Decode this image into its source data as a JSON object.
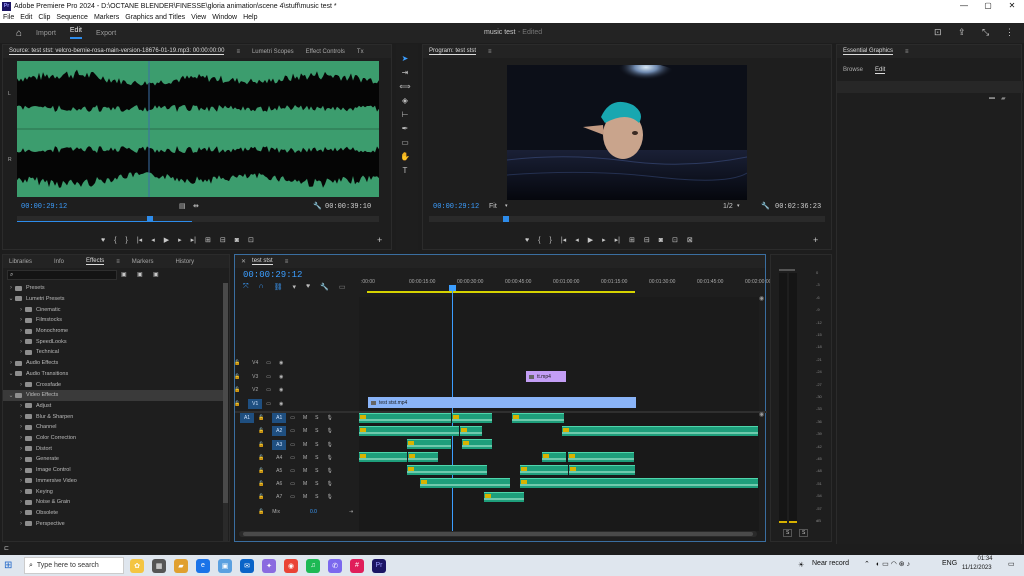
{
  "window": {
    "title": "Adobe Premiere Pro 2024 - D:\\OCTANE BLENDER\\FINESSE\\gloria  animation\\scene 4\\stuff\\music test *",
    "logo": "Pr",
    "controls": [
      "—",
      "▢",
      "✕"
    ]
  },
  "menu": [
    "File",
    "Edit",
    "Clip",
    "Sequence",
    "Markers",
    "Graphics and Titles",
    "View",
    "Window",
    "Help"
  ],
  "workspace": {
    "tabs": [
      "Import",
      "Edit",
      "Export"
    ],
    "active": "Edit",
    "project_title": "music test",
    "project_status": "- Edited"
  },
  "source_panel": {
    "tabs": [
      "Source: test stst: velcro-bernie-rosa-main-version-18676-01-19.mp3: 00:00:00:00",
      "Lumetri Scopes",
      "Effect Controls",
      "Tx"
    ],
    "channel_left": "L",
    "channel_right": "R",
    "timecode_current": "00:00:29:12",
    "timecode_duration": "00:00:39:10"
  },
  "program_panel": {
    "title": "Program: test stst",
    "timecode_current": "00:00:29:12",
    "fit": "Fit",
    "resolution": "1/2",
    "timecode_duration": "00:02:36:23"
  },
  "essential_graphics": {
    "title": "Essential Graphics",
    "tabs": [
      "Browse",
      "Edit"
    ],
    "active_tab": "Edit"
  },
  "effects_panel": {
    "tabs": [
      "Libraries",
      "Info",
      "Effects",
      "Markers",
      "History"
    ],
    "active_tab": "Effects",
    "search_placeholder": "",
    "tree": [
      {
        "label": "Presets",
        "level": 0,
        "open": false
      },
      {
        "label": "Lumetri Presets",
        "level": 0,
        "open": true
      },
      {
        "label": "Cinematic",
        "level": 1,
        "open": false
      },
      {
        "label": "Filmstocks",
        "level": 1,
        "open": false
      },
      {
        "label": "Monochrome",
        "level": 1,
        "open": false
      },
      {
        "label": "SpeedLooks",
        "level": 1,
        "open": false
      },
      {
        "label": "Technical",
        "level": 1,
        "open": false
      },
      {
        "label": "Audio Effects",
        "level": 0,
        "open": false
      },
      {
        "label": "Audio Transitions",
        "level": 0,
        "open": true
      },
      {
        "label": "Crossfade",
        "level": 1,
        "open": false
      },
      {
        "label": "Video Effects",
        "level": 0,
        "open": true,
        "selected": true
      },
      {
        "label": "Adjust",
        "level": 1,
        "open": false
      },
      {
        "label": "Blur & Sharpen",
        "level": 1,
        "open": false
      },
      {
        "label": "Channel",
        "level": 1,
        "open": false
      },
      {
        "label": "Color Correction",
        "level": 1,
        "open": false
      },
      {
        "label": "Distort",
        "level": 1,
        "open": false
      },
      {
        "label": "Generate",
        "level": 1,
        "open": false
      },
      {
        "label": "Image Control",
        "level": 1,
        "open": false
      },
      {
        "label": "Immersive Video",
        "level": 1,
        "open": false
      },
      {
        "label": "Keying",
        "level": 1,
        "open": false
      },
      {
        "label": "Noise & Grain",
        "level": 1,
        "open": false
      },
      {
        "label": "Obsolete",
        "level": 1,
        "open": false
      },
      {
        "label": "Perspective",
        "level": 1,
        "open": false
      }
    ]
  },
  "timeline": {
    "sequence_tab": "test stst",
    "timecode": "00:00:29:12",
    "ruler": [
      ":00:00",
      "00:00:15:00",
      "00:00:30:00",
      "00:00:45:00",
      "00:01:00:00",
      "00:01:15:00",
      "00:01:30:00",
      "00:01:45:00",
      "00:02:00:00"
    ],
    "video_tracks": [
      "V4",
      "V3",
      "V2",
      "V1"
    ],
    "audio_tracks": [
      "A1",
      "A2",
      "A3",
      "A4",
      "A5",
      "A6",
      "A7"
    ],
    "source_patch": "A1",
    "mix_label": "Mix",
    "mix_value": "0.0",
    "track_buttons": {
      "mute": "M",
      "solo": "S"
    },
    "video_clips": [
      {
        "name": "tt.mp4",
        "track": "V3"
      },
      {
        "name": "test stst.mp4",
        "track": "V1"
      }
    ],
    "fx_badge": "fx",
    "clip_badge_a4": "fx"
  },
  "audio_meter": {
    "ticks": [
      "0",
      "-3",
      "-6",
      "-9",
      "-12",
      "-15",
      "-18",
      "-21",
      "-24",
      "-27",
      "-30",
      "-33",
      "-36",
      "-39",
      "-42",
      "-45",
      "-48",
      "-51",
      "-54",
      "-57",
      "dB"
    ],
    "solo_buttons": [
      "S",
      "S"
    ]
  },
  "taskbar": {
    "search_placeholder": "Type here to search",
    "weather": "Near record",
    "language": "ENG",
    "time": "01:34",
    "date": "11/12/2023"
  },
  "colors": {
    "accent_blue": "#2d8ceb",
    "audio_clip": "#1e9e7b",
    "video_clip_v1": "#8ab4f8",
    "video_clip_v3": "#c39ef5",
    "waveform_bg": "#3c9d6e"
  }
}
